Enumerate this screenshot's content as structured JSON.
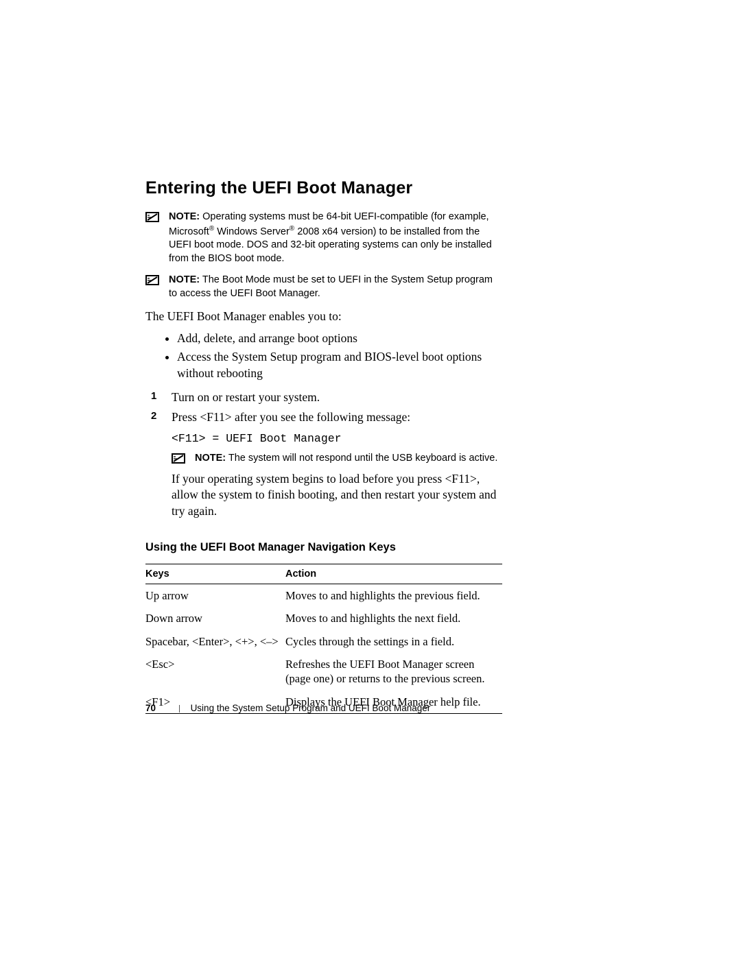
{
  "heading": "Entering the UEFI Boot Manager",
  "notes": {
    "label": "NOTE:",
    "n1_pre": " Operating systems must be 64-bit UEFI-compatible (for example, Microsoft",
    "n1_mid": " Windows Server",
    "n1_post": " 2008 x64 version) to be installed from the UEFI boot mode. DOS and 32-bit operating systems can only be installed from the BIOS boot mode.",
    "n2": " The Boot Mode must be set to UEFI in the System Setup program to access the UEFI Boot Manager.",
    "n3": " The system will not respond until the USB keyboard is active."
  },
  "intro": "The UEFI Boot Manager enables you to:",
  "bullets": [
    "Add, delete, and arrange boot options",
    "Access the System Setup program and BIOS-level boot options without rebooting"
  ],
  "steps": {
    "s1": "Turn on or restart your system.",
    "s2": "Press <F11> after you see the following message:",
    "s2_code": "<F11> = UEFI Boot Manager",
    "s2_after": "If your operating system begins to load before you press <F11>, allow the system to finish booting, and then restart your system and try again."
  },
  "step_nums": {
    "n1": "1",
    "n2": "2"
  },
  "subheading": "Using the UEFI Boot Manager Navigation Keys",
  "table": {
    "headers": {
      "keys": "Keys",
      "action": "Action"
    },
    "rows": [
      {
        "k": "Up arrow",
        "a": "Moves to and highlights the previous field."
      },
      {
        "k": "Down arrow",
        "a": "Moves to and highlights the next field."
      },
      {
        "k": "Spacebar, <Enter>, <+>, <–>",
        "a": "Cycles through the settings in a field."
      },
      {
        "k": "<Esc>",
        "a": "Refreshes the UEFI Boot Manager screen (page one) or returns to the previous screen."
      },
      {
        "k": "<F1>",
        "a": "Displays the UEFI Boot Manager help file."
      }
    ]
  },
  "footer": {
    "page": "70",
    "title": "Using the System Setup Program and UEFI Boot Manager"
  },
  "reg": "®"
}
